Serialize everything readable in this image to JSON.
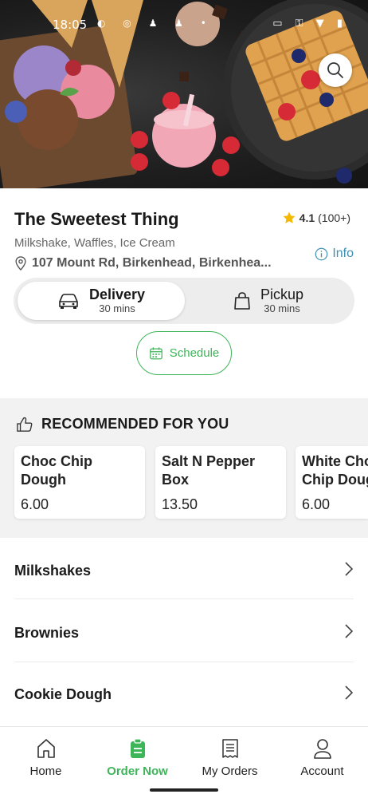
{
  "status_bar": {
    "time": "18:05",
    "left_icons": "◐ ◎ ♟ ♟ •",
    "right_icons": "▭ ⚿ ▼ ▮"
  },
  "store": {
    "name": "The Sweetest Thing",
    "rating": "4.1",
    "rating_count": "(100+)",
    "categories": "Milkshake, Waffles, Ice Cream",
    "address": "107 Mount Rd, Birkenhead, Birkenhea...",
    "info_label": "Info"
  },
  "order_type": {
    "delivery": {
      "label": "Delivery",
      "time": "30 mins"
    },
    "pickup": {
      "label": "Pickup",
      "time": "30 mins"
    },
    "schedule_label": "Schedule"
  },
  "recommended": {
    "title": "RECOMMENDED FOR YOU",
    "items": [
      {
        "name": "Choc Chip\nDough",
        "price": "6.00"
      },
      {
        "name": "Salt N Pepper\nBox",
        "price": "13.50"
      },
      {
        "name": "White Choc\nChip Dough",
        "price": "6.00"
      }
    ]
  },
  "menu_categories": [
    {
      "label": "Milkshakes"
    },
    {
      "label": "Brownies"
    },
    {
      "label": "Cookie Dough"
    }
  ],
  "bottom_nav": [
    {
      "label": "Home",
      "icon": "home-icon"
    },
    {
      "label": "Order Now",
      "icon": "order-icon",
      "active": true
    },
    {
      "label": "My Orders",
      "icon": "receipt-icon"
    },
    {
      "label": "Account",
      "icon": "person-icon"
    }
  ],
  "colors": {
    "accent_green": "#3fb55a",
    "info_blue": "#3f8fb3",
    "star": "#f5b800"
  }
}
